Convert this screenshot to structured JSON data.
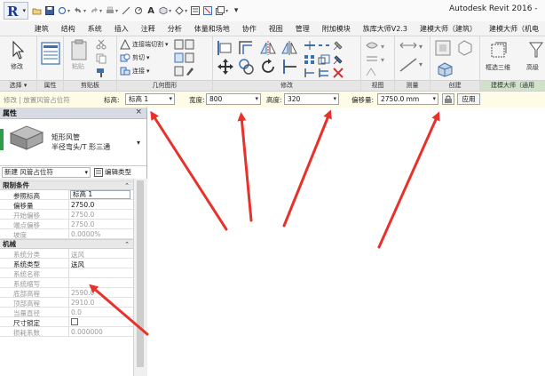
{
  "app": {
    "title": "Autodesk Revit 2016 -"
  },
  "quick_access": {
    "icons": [
      "revit-app-menu-icon",
      "open-icon",
      "save-icon",
      "sync-icon",
      "undo-icon",
      "redo-icon",
      "print-icon",
      "measure-icon",
      "dimension-icon",
      "text-A-icon",
      "3d-view-icon",
      "section-icon",
      "thin-lines-icon",
      "close-windows-icon",
      "switch-windows-icon",
      "customize-icon"
    ]
  },
  "menu": {
    "items": [
      "建筑",
      "结构",
      "系统",
      "插入",
      "注释",
      "分析",
      "体量和场地",
      "协作",
      "视图",
      "管理",
      "附加模块",
      "族库大师V2.3",
      "建模大师（建筑）",
      "建模大师（机电"
    ]
  },
  "ribbon": {
    "modify_label": "修改",
    "clipboard": {
      "paste_label": "粘贴",
      "label": "剪贴板"
    },
    "geometry": {
      "cope_label": "连接端切割",
      "cut_label": "剪切",
      "join_label": "连接",
      "label": "几何图形"
    },
    "panels": {
      "select": "选择",
      "properties": "属性",
      "modify": "修改",
      "view": "视图",
      "measure": "测量",
      "create": "创建",
      "bim_master": "建模大师（通用"
    },
    "bim_tools": {
      "frame_3d": "框选三维",
      "advanced": "高级"
    }
  },
  "option_bar": {
    "status": "修改 | 放置风管占位符",
    "level_label": "标高:",
    "level_value": "标高 1",
    "width_label": "宽度:",
    "width_value": "800",
    "height_label": "高度:",
    "height_value": "320",
    "offset_label": "偏移量:",
    "offset_value": "2750.0 mm",
    "apply_label": "应用"
  },
  "properties": {
    "title": "属性",
    "close": "×",
    "type_line1": "矩形风管",
    "type_line2": "半径弯头/T 形三通",
    "instance_selector": "新建 风管占位符",
    "edit_type": "编辑类型",
    "groups": [
      {
        "name": "限制条件",
        "rows": [
          {
            "name": "参照标高",
            "value": "标高 1",
            "editable": true,
            "boxed": true
          },
          {
            "name": "偏移量",
            "value": "2750.0",
            "editable": true
          },
          {
            "name": "开始偏移",
            "value": "2750.0",
            "editable": false
          },
          {
            "name": "端点偏移",
            "value": "2750.0",
            "editable": false
          },
          {
            "name": "坡度",
            "value": "0.0000%",
            "editable": false
          }
        ]
      },
      {
        "name": "机械",
        "rows": [
          {
            "name": "系统分类",
            "value": "送风",
            "editable": false
          },
          {
            "name": "系统类型",
            "value": "送风",
            "editable": true
          },
          {
            "name": "系统名称",
            "value": "",
            "editable": false
          },
          {
            "name": "系统缩写",
            "value": "",
            "editable": false
          },
          {
            "name": "底部高程",
            "value": "2590.0",
            "editable": false
          },
          {
            "name": "顶部高程",
            "value": "2910.0",
            "editable": false
          },
          {
            "name": "当量直径",
            "value": "0.0",
            "editable": false
          },
          {
            "name": "尺寸锁定",
            "value": "",
            "editable": true,
            "checkbox": true
          },
          {
            "name": "损耗系数",
            "value": "0.000000",
            "editable": false
          }
        ]
      }
    ]
  },
  "colors": {
    "annotation_arrow": "#e8312a",
    "option_bar_bg": "#fefce6",
    "green_panel": "#cfe3c9"
  }
}
